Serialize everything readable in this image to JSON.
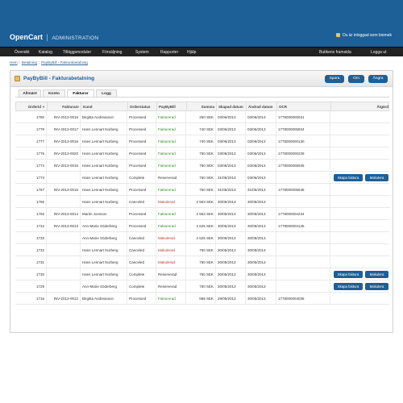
{
  "header": {
    "logo": "OpenCart",
    "logo_sep": "|",
    "logo_sub": "ADMINISTRATION",
    "login_status": "Du är inloggad som biomek"
  },
  "menu": {
    "items": [
      "Översikt",
      "Katalog",
      "Tilläggsmoduler",
      "Försäljning",
      "System",
      "Rapporter",
      "Hjälp"
    ],
    "right": [
      "Butikens framsida",
      "Logga ut"
    ]
  },
  "breadcrumb": [
    "Hem",
    "Betalning",
    "PayByBill - Fakturabetalning"
  ],
  "breadcrumb_sep": "::",
  "panel": {
    "title": "PayByBill - Fakturabetalning",
    "buttons": [
      "Spara",
      "Om",
      "Ångra"
    ]
  },
  "tabs": [
    "Allmänt",
    "Konto",
    "Fakturor",
    "Logg"
  ],
  "active_tab": "Fakturor",
  "table": {
    "columns": [
      "Orderid",
      "Fakturanr",
      "Kund",
      "Orderstatus",
      "PayByBill",
      "Summa",
      "Skapad datum",
      "Ändrad datum",
      "OCR",
      "Åtgärd"
    ],
    "sort_icon": "▼",
    "rows": [
      [
        "1780",
        "INV-2013-0018",
        "Birgitta Andreasson",
        "Processed",
        "Fakturerad",
        "250 SEK",
        "03/06/2013",
        "03/06/2013",
        "1778000000031",
        ""
      ],
      [
        "1779",
        "INV-2013-0017",
        "Hans Lennart Norberg",
        "Processed",
        "Fakturerad",
        "740 SEK",
        "03/06/2013",
        "03/06/2013",
        "1778000005934",
        ""
      ],
      [
        "1777",
        "INV-2013-0016",
        "Hans Lennart Norberg",
        "Processed",
        "Fakturerad",
        "740 SEK",
        "03/06/2013",
        "03/06/2013",
        "1778000000130",
        ""
      ],
      [
        "1775",
        "INV-2013-0020",
        "Hans Lennart Norberg",
        "Processed",
        "Fakturerad",
        "750 SEK",
        "03/06/2013",
        "03/06/2013",
        "1778000000239",
        ""
      ],
      [
        "1774",
        "INV-2013-0016",
        "Hans Lennart Norberg",
        "Processed",
        "Fakturerad",
        "750 SEK",
        "03/06/2013",
        "03/06/2013",
        "1778000005935",
        ""
      ],
      [
        "1773",
        "",
        "Hans Lennart Norberg",
        "Complete",
        "Reserverad",
        "750 SEK",
        "31/05/2013",
        "03/06/2013",
        "",
        "actions"
      ],
      [
        "1767",
        "INV-2013-0015",
        "Hans Lennart Norberg",
        "Processed",
        "Fakturerad",
        "750 SEK",
        "31/05/2013",
        "31/05/2013",
        "1778000005538",
        ""
      ],
      [
        "1766",
        "",
        "Hans Lennart Norberg",
        "Canceled",
        "Makulerad",
        "2 563 SEK",
        "30/05/2013",
        "30/05/2013",
        "",
        ""
      ],
      [
        "1765",
        "INV-2013-0014",
        "Martin Jonsson",
        "Processed",
        "Fakturerad",
        "2 563 SEK",
        "30/05/2013",
        "30/05/2013",
        "1778000004234",
        ""
      ],
      [
        "1734",
        "INV-2013-0013",
        "Ann-Marie Söderberg",
        "Processed",
        "Fakturerad",
        "2 625 SEK",
        "30/05/2013",
        "30/05/2013",
        "1778000004135",
        ""
      ],
      [
        "1733",
        "",
        "Ann-Marie Söderberg",
        "Canceled",
        "Makulerad",
        "2 625 SEK",
        "30/05/2013",
        "30/05/2013",
        "",
        ""
      ],
      [
        "1732",
        "",
        "Hans Lennart Norberg",
        "Canceled",
        "Makulerad",
        "750 SEK",
        "30/05/2013",
        "30/05/2013",
        "",
        ""
      ],
      [
        "1731",
        "",
        "Hans Lennart Norberg",
        "Canceled",
        "Makulerad",
        "750 SEK",
        "30/05/2013",
        "30/05/2013",
        "",
        ""
      ],
      [
        "1730",
        "",
        "Hans Lennart Norberg",
        "Complete",
        "Reserverad",
        "750 SEK",
        "30/05/2013",
        "30/05/2013",
        "",
        "actions"
      ],
      [
        "1729",
        "",
        "Ann-Marie Söderberg",
        "Complete",
        "Reserverad",
        "750 SEK",
        "30/05/2013",
        "30/05/2013",
        "",
        "actions"
      ],
      [
        "1716",
        "INV-2013-0012",
        "Birgitta Andreasson",
        "Processed",
        "Fakturerad",
        "688 SEK",
        "29/05/2013",
        "30/05/2013",
        "1778000004035",
        ""
      ]
    ],
    "action_labels": [
      "Skapa faktura",
      "Makulera"
    ]
  },
  "colors": {
    "brand": "#1d5f97",
    "fakturerad": "#3a8a2a",
    "makulerad": "#c0392b"
  }
}
